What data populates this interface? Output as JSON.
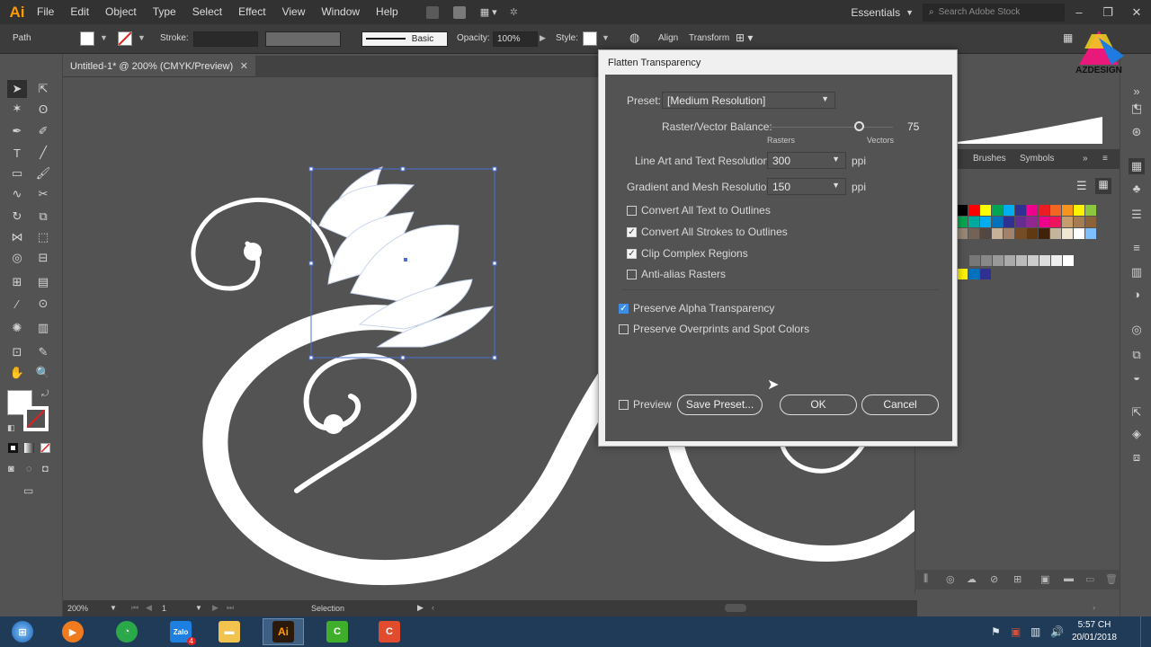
{
  "app": {
    "logo": "Ai"
  },
  "menu": {
    "items": [
      "File",
      "Edit",
      "Object",
      "Type",
      "Select",
      "Effect",
      "View",
      "Window",
      "Help"
    ],
    "workspace": "Essentials",
    "search_placeholder": "Search Adobe Stock"
  },
  "control_bar": {
    "selection_type": "Path",
    "stroke_label": "Stroke:",
    "brush_style": "Basic",
    "opacity_label": "Opacity:",
    "opacity_value": "100%",
    "style_label": "Style:",
    "align_label": "Align",
    "transform_label": "Transform"
  },
  "document": {
    "tab_title": "Untitled-1* @ 200% (CMYK/Preview)",
    "zoom": "200%",
    "artboard_number": "1",
    "status_text": "Selection"
  },
  "panels": {
    "tabs": [
      "Brushes",
      "Symbols"
    ]
  },
  "logo_watermark": "AZDESIGN",
  "dialog": {
    "title": "Flatten Transparency",
    "preset_label": "Preset:",
    "preset_value": "[Medium Resolution]",
    "balance_label": "Raster/Vector Balance:",
    "balance_value": "75",
    "rasters_label": "Rasters",
    "vectors_label": "Vectors",
    "line_art_label": "Line Art and Text Resolution:",
    "line_art_value": "300",
    "gradient_label": "Gradient and Mesh Resolution:",
    "gradient_value": "150",
    "ppi": "ppi",
    "checkboxes": [
      {
        "label": "Convert All Text to Outlines",
        "checked": false
      },
      {
        "label": "Convert All Strokes to Outlines",
        "checked": true
      },
      {
        "label": "Clip Complex Regions",
        "checked": true
      },
      {
        "label": "Anti-alias Rasters",
        "checked": false
      }
    ],
    "preserve_alpha": {
      "label": "Preserve Alpha Transparency",
      "checked": true
    },
    "preserve_overprints": {
      "label": "Preserve Overprints and Spot Colors",
      "checked": false
    },
    "preview_label": "Preview",
    "save_preset_label": "Save Preset...",
    "ok_label": "OK",
    "cancel_label": "Cancel"
  },
  "taskbar": {
    "apps": [
      "start",
      "media-player",
      "chrome",
      "zalo",
      "explorer",
      "illustrator",
      "camtasia-green",
      "camtasia-red"
    ],
    "zalo_badge": "4",
    "time": "5:57 CH",
    "date": "20/01/2018"
  },
  "colors": {
    "accent": "#3f8ee6",
    "dialog_bg": "#535353",
    "taskbar": "#1f3b57",
    "app_orange": "#ff9a00"
  }
}
